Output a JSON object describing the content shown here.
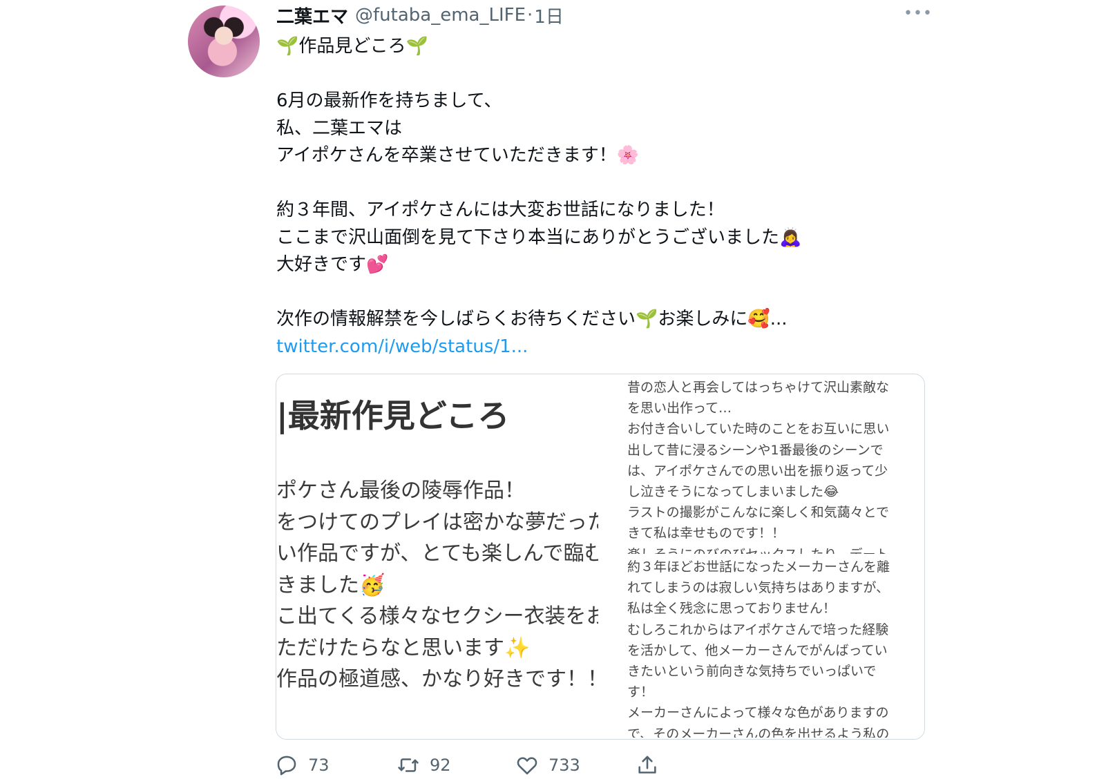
{
  "tweet": {
    "author_name": "二葉エマ",
    "author_handle": "@futaba_ema_LIFE",
    "separator": "·",
    "time": "1日",
    "more_icon": "more-horizontal-icon",
    "lines": [
      "🌱作品見どころ🌱",
      "",
      "6月の最新作を持ちまして、",
      "私、二葉エマは",
      "アイポケさんを卒業させていただきます！🌸",
      "",
      "約３年間、アイポケさんには大変お世話になりました！",
      "ここまで沢山面倒を見て下さり本当にありがとうございました🙇‍♀️",
      "大好きです💕",
      "",
      "次作の情報解禁を今しばらくお待ちください🌱お楽しみに🥰..."
    ],
    "link": "twitter.com/i/web/status/1..."
  },
  "card": {
    "left_title": "|最新作見どころ",
    "left_lines": [
      "ポケさん最後の陵辱作品！",
      "をつけてのプレイは密かな夢だった",
      "い作品ですが、とても楽しんで臨む",
      "きました🥳",
      "こ出てくる様々なセクシー衣装をお",
      "ただけたらなと思います✨",
      "作品の極道感、かなり好きです！！"
    ],
    "right_block1": [
      "昔の恋人と再会してはっちゃけて沢山素敵な",
      "を思い出作って…",
      "お付き合いしていた時のことをお互いに思い",
      "出して昔に浸るシーンや1番最後のシーンで",
      "は、アイポケさんでの思い出を振り返って少",
      "し泣きそうになってしまいました😂",
      "ラストの撮影がこんなに楽しく和気藹々とで",
      "きて私は幸せものです！！",
      "楽しそうにのびのびセックスしたり、デート"
    ],
    "right_block2": [
      "約３年ほどお世話になったメーカーさんを離",
      "れてしまうのは寂しい気持ちはありますが、",
      "私は全く残念に思っておりません！",
      "むしろこれからはアイポケさんで培った経験",
      "を活かして、他メーカーさんでがんばってい",
      "きたいという前向きな気持ちでいっぱいで",
      "す！",
      "メーカーさんによって様々な色がありますの",
      "で、そのメーカーさんの色を出せるよう私の"
    ]
  },
  "actions": {
    "reply_count": "73",
    "retweet_count": "92",
    "like_count": "733",
    "reply_icon": "reply-icon",
    "retweet_icon": "retweet-icon",
    "like_icon": "heart-icon",
    "share_icon": "share-icon"
  },
  "colors": {
    "link": "#1d9bf0",
    "secondary_text": "#536471",
    "border": "#cfd9de"
  }
}
